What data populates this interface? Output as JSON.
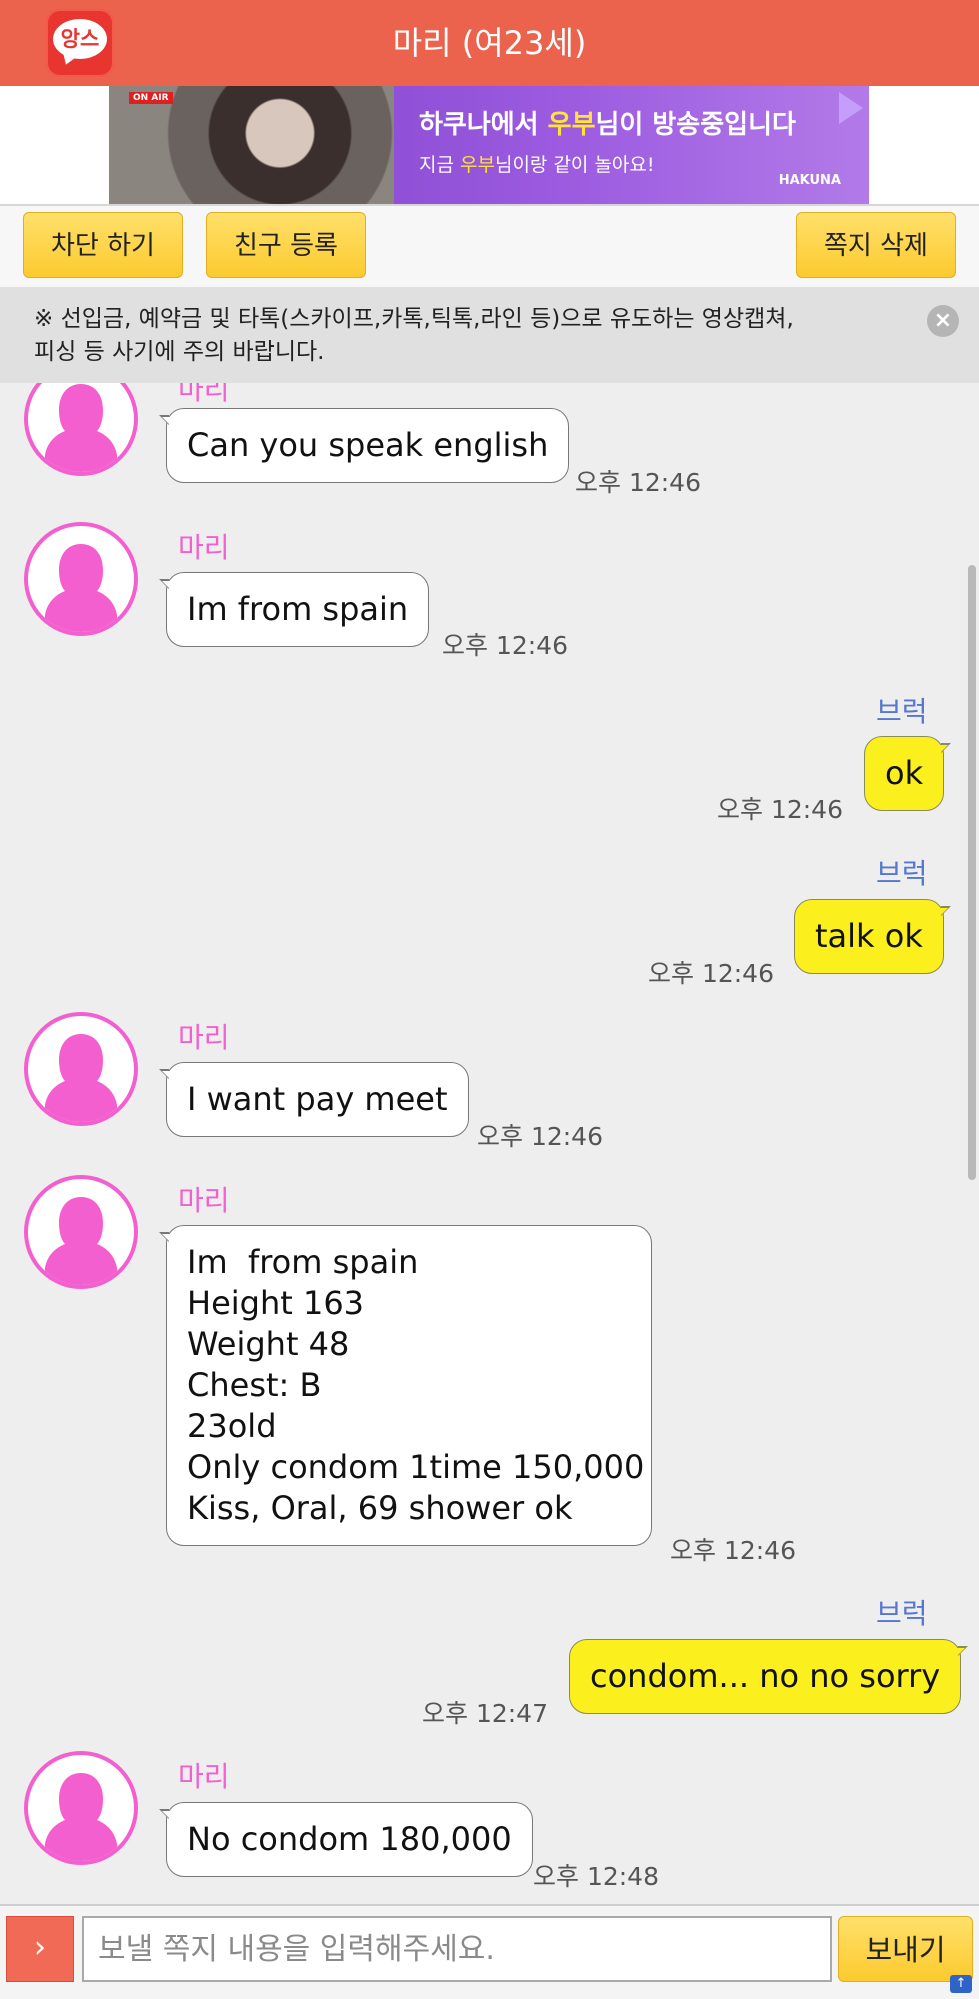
{
  "header": {
    "title": "마리 (여23세)",
    "logo_text": "앙스"
  },
  "banner": {
    "onair": "ON AIR",
    "line1_pre": "하쿠나에서 ",
    "line1_hl": "우부",
    "line1_post": "님이 방송중입니다",
    "line2_pre": "지금 ",
    "line2_hl": "우부",
    "line2_post": "님이랑 같이 놀아요!",
    "brand": "HAKUNA"
  },
  "actions": {
    "block": "차단 하기",
    "friend": "친구 등록",
    "delete": "쪽지 삭제"
  },
  "notice": {
    "text": "※ 선입금, 예약금 및 타톡(스카이프,카톡,틱톡,라인 등)으로 유도하는 영상캡쳐,피싱 등 사기에 주의 바랍니다.",
    "close_glyph": "×"
  },
  "messages": [
    {
      "from": "them",
      "name": "마리",
      "text": "Can you speak english",
      "time": "오후 12:46"
    },
    {
      "from": "them",
      "name": "마리",
      "text": "Im from spain",
      "time": "오후 12:46"
    },
    {
      "from": "me",
      "name": "브럭",
      "text": "ok",
      "time": "오후 12:46"
    },
    {
      "from": "me",
      "name": "브럭",
      "text": "talk ok",
      "time": "오후 12:46"
    },
    {
      "from": "them",
      "name": "마리",
      "text": "I want pay meet",
      "time": "오후 12:46"
    },
    {
      "from": "them",
      "name": "마리",
      "text": "Im  from spain\nHeight 163\nWeight 48\nChest: B\n23old\nOnly condom 1time 150,000\nKiss, Oral, 69 shower ok",
      "time": "오후 12:46"
    },
    {
      "from": "me",
      "name": "브럭",
      "text": "condom... no no sorry",
      "time": "오후 12:47"
    },
    {
      "from": "them",
      "name": "마리",
      "text": "No condom 180,000",
      "time": "오후 12:48"
    }
  ],
  "composer": {
    "expand_glyph": "›",
    "placeholder": "보낼 쪽지 내용을 입력해주세요.",
    "send": "보내기"
  },
  "colors": {
    "header": "#ec634d",
    "them_name": "#f45fd0",
    "me_name": "#5577d0",
    "my_bubble": "#fcef1e",
    "button": "#fcca2f"
  }
}
